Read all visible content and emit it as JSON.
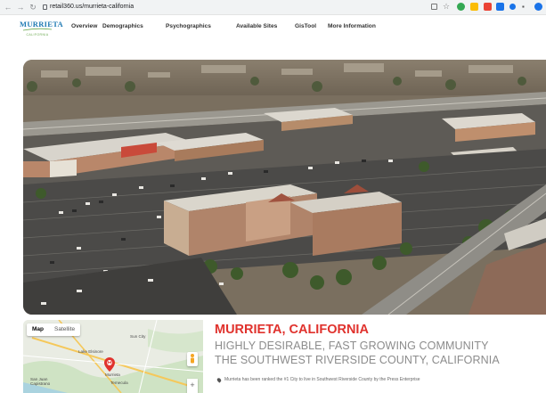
{
  "browser": {
    "url": "retail360.us/murrieta-california",
    "back_icon": "arrow-left-icon",
    "forward_icon": "arrow-right-icon",
    "reload_icon": "reload-icon"
  },
  "site": {
    "logo_text": "MURRIETA",
    "logo_subtext": "CALIFORNIA",
    "nav": [
      "Overview",
      "Demographics",
      "Psychographics",
      "Available Sites",
      "GisTool",
      "More Information"
    ]
  },
  "map": {
    "tabs": [
      "Map",
      "Satellite"
    ],
    "active_tab": "Map",
    "labels": [
      "Lake Elsinore",
      "Murrieta",
      "Temecula",
      "Sun City",
      "San Juan Capistrano"
    ],
    "zoom_in": "+"
  },
  "info": {
    "title": "MURRIETA, CALIFORNIA",
    "tagline_1": "HIGHLY DESIRABLE, FAST GROWING COMMUNITY",
    "tagline_2": "THE SOUTHWEST RIVERSIDE COUNTY, CALIFORNIA",
    "bullet_1": "Murrieta has been ranked the #1 City to live in Southwest Riverside County by the Press Enterprise"
  },
  "colors": {
    "accent_red": "#e0322d",
    "logo_blue": "#1f7ab3",
    "tagline_gray": "#8c8c8c"
  }
}
